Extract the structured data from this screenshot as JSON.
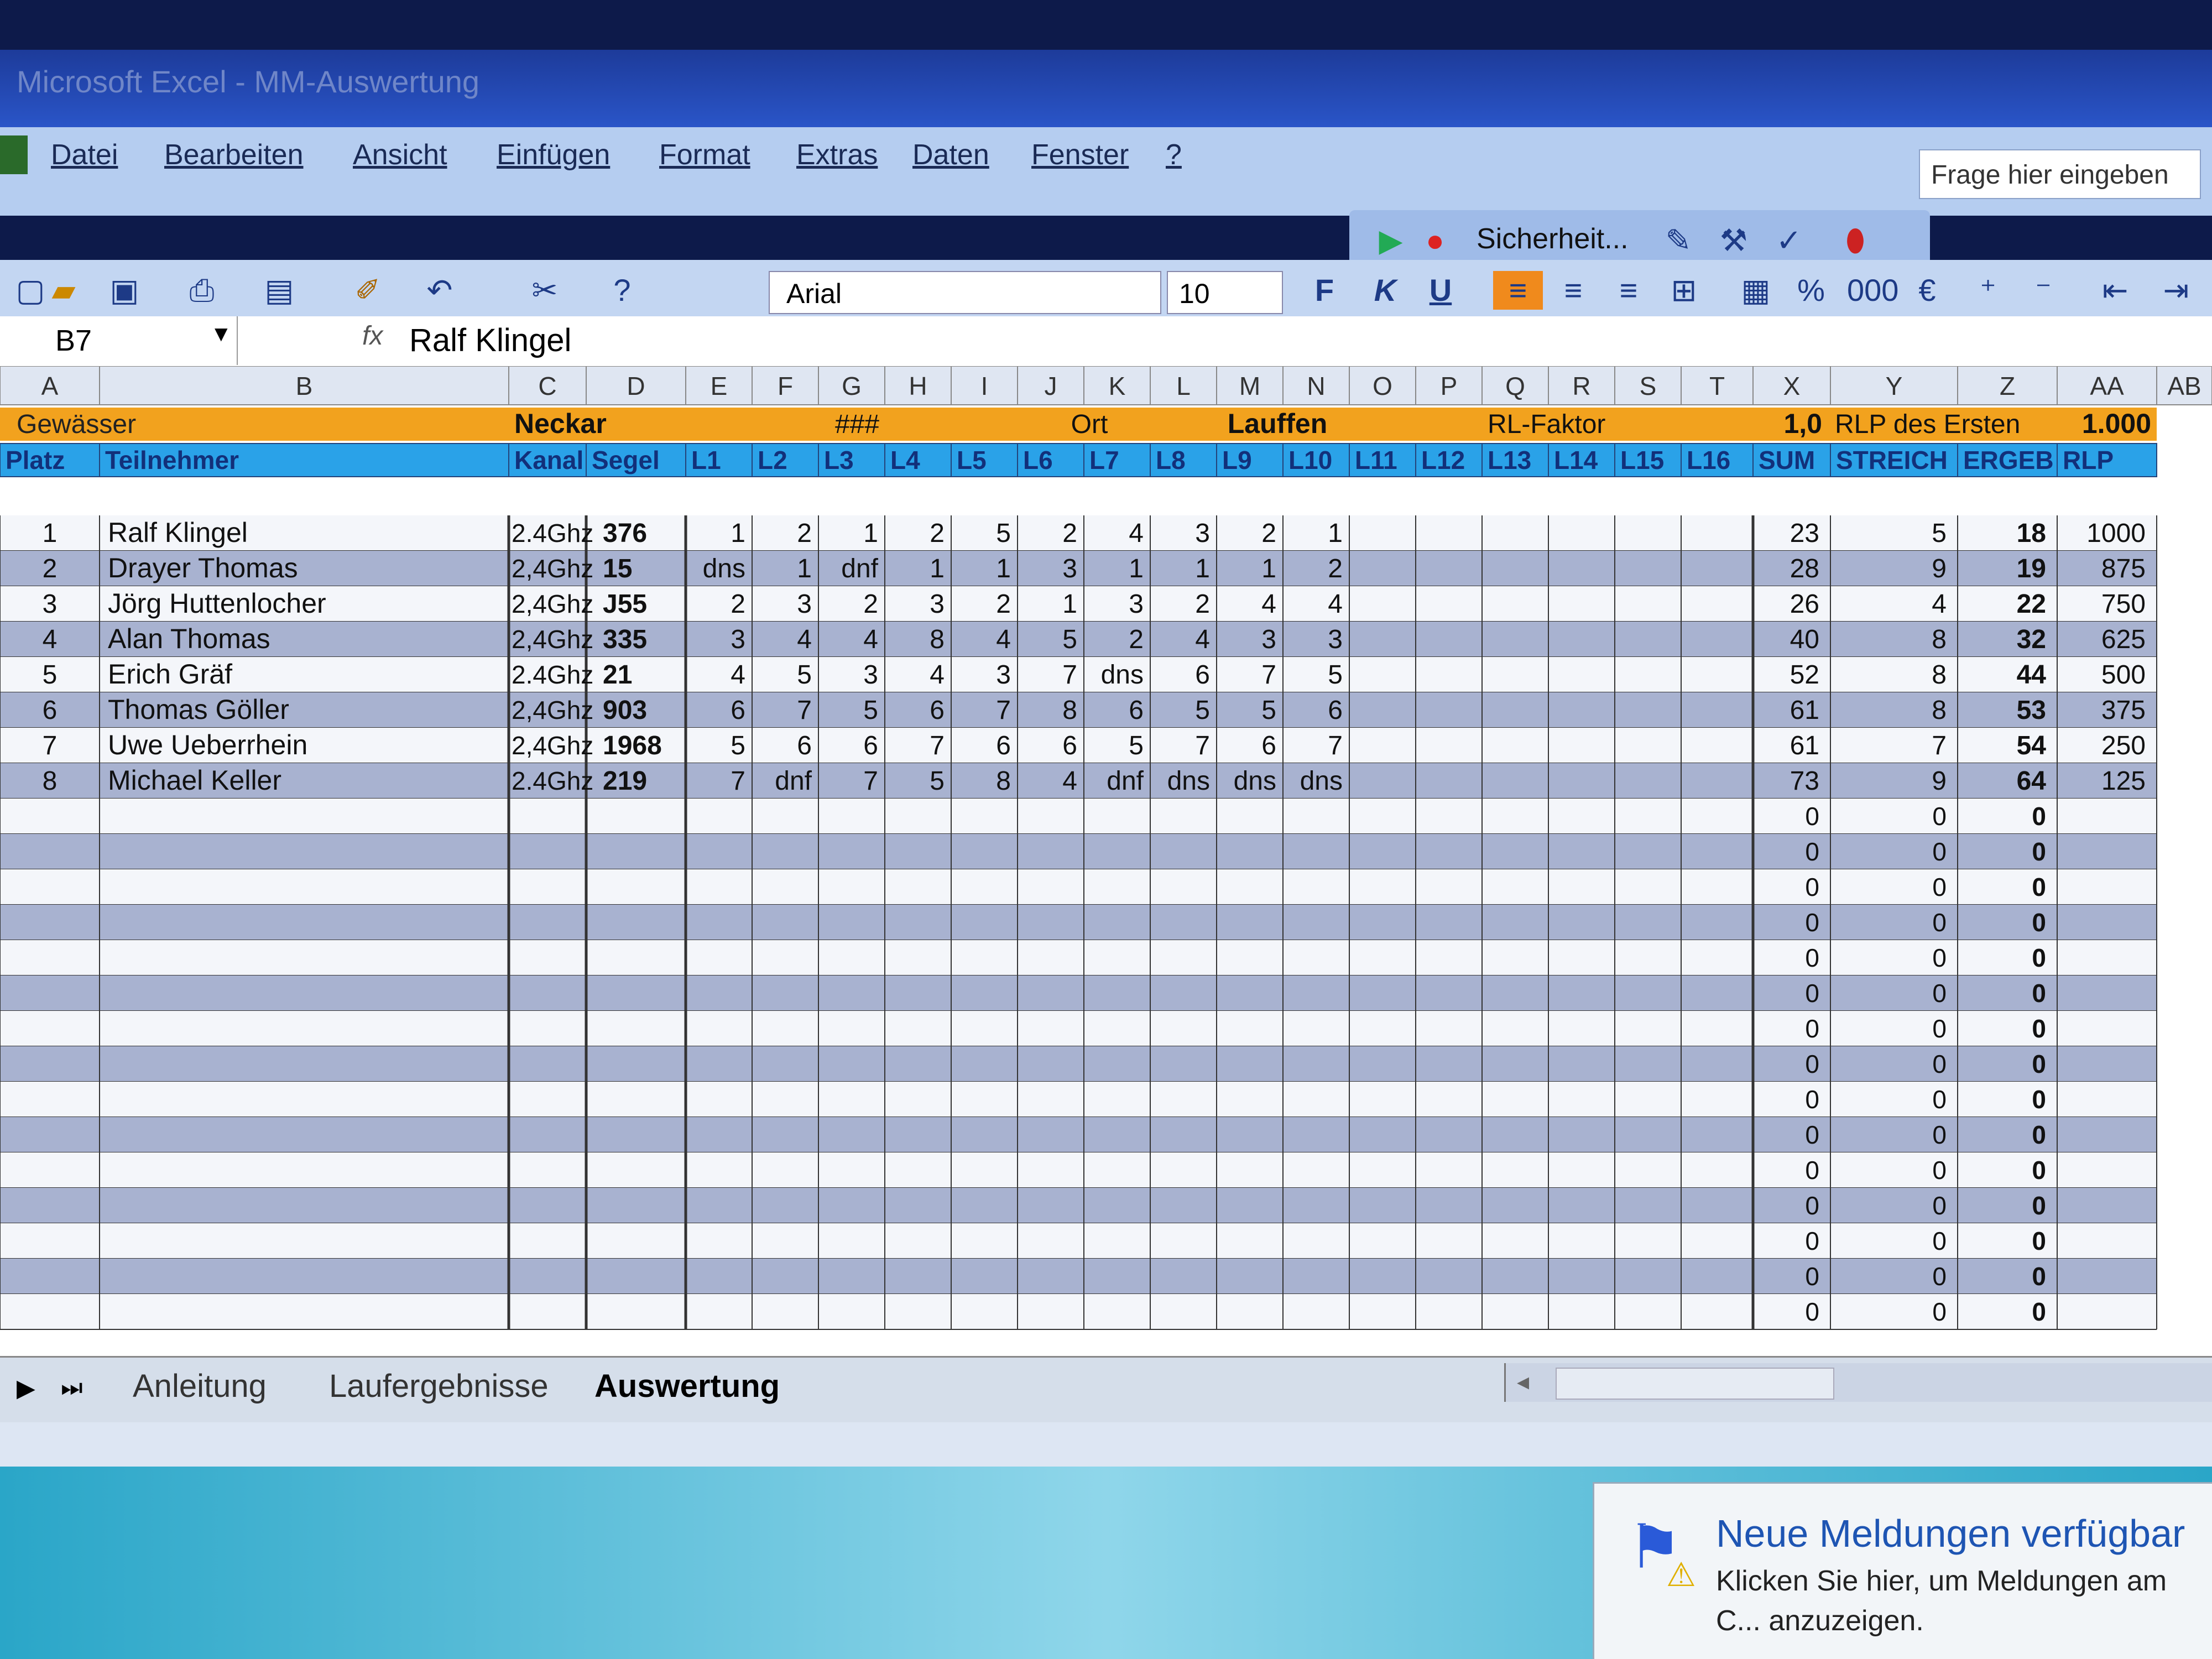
{
  "window": {
    "title": "Microsoft Excel - MM-Auswertung"
  },
  "menu": [
    "Datei",
    "Bearbeiten",
    "Ansicht",
    "Einfügen",
    "Format",
    "Extras",
    "Daten",
    "Fenster",
    "?"
  ],
  "ask_placeholder": "Frage hier eingeben",
  "security_label": "Sicherheit...",
  "font": "Arial",
  "font_size": "10",
  "format_buttons": [
    "F",
    "K",
    "U"
  ],
  "name_box": "B7",
  "formula_value": "Ralf Klingel",
  "columns": [
    "A",
    "B",
    "C",
    "D",
    "E",
    "F",
    "G",
    "H",
    "I",
    "J",
    "K",
    "L",
    "M",
    "N",
    "O",
    "P",
    "Q",
    "R",
    "S",
    "T",
    "X",
    "Y",
    "Z",
    "AA",
    "AB"
  ],
  "header_row1": {
    "gewaesser_label": "Gewässer",
    "gewaesser_value": "Neckar",
    "hash": "###",
    "ort_label": "Ort",
    "ort_value": "Lauffen",
    "rl_label": "RL-Faktor",
    "rl_value": "1,0",
    "rlp_label": "RLP des Ersten",
    "rlp_value": "1.000"
  },
  "header_row2": [
    "Platz",
    "Teilnehmer",
    "Kanal",
    "Segel",
    "L1",
    "L2",
    "L3",
    "L4",
    "L5",
    "L6",
    "L7",
    "L8",
    "L9",
    "L10",
    "L11",
    "L12",
    "L13",
    "L14",
    "L15",
    "L16",
    "SUM",
    "STREICH",
    "ERGEB",
    "RLP"
  ],
  "rows": [
    {
      "platz": "1",
      "name": "Ralf Klingel",
      "kanal": "2.4Ghz",
      "segel": "376",
      "laeufe": [
        "1",
        "2",
        "1",
        "2",
        "5",
        "2",
        "4",
        "3",
        "2",
        "1"
      ],
      "sum": "23",
      "streich": "5",
      "ergeb": "18",
      "rlp": "1000"
    },
    {
      "platz": "2",
      "name": "Drayer Thomas",
      "kanal": "2,4Ghz",
      "segel": "15",
      "laeufe": [
        "dns",
        "1",
        "dnf",
        "1",
        "1",
        "3",
        "1",
        "1",
        "1",
        "2"
      ],
      "sum": "28",
      "streich": "9",
      "ergeb": "19",
      "rlp": "875"
    },
    {
      "platz": "3",
      "name": "Jörg Huttenlocher",
      "kanal": "2,4Ghz",
      "segel": "J55",
      "laeufe": [
        "2",
        "3",
        "2",
        "3",
        "2",
        "1",
        "3",
        "2",
        "4",
        "4"
      ],
      "sum": "26",
      "streich": "4",
      "ergeb": "22",
      "rlp": "750"
    },
    {
      "platz": "4",
      "name": "Alan Thomas",
      "kanal": "2,4Ghz",
      "segel": "335",
      "laeufe": [
        "3",
        "4",
        "4",
        "8",
        "4",
        "5",
        "2",
        "4",
        "3",
        "3"
      ],
      "sum": "40",
      "streich": "8",
      "ergeb": "32",
      "rlp": "625"
    },
    {
      "platz": "5",
      "name": "Erich Gräf",
      "kanal": "2.4Ghz",
      "segel": "21",
      "laeufe": [
        "4",
        "5",
        "3",
        "4",
        "3",
        "7",
        "dns",
        "6",
        "7",
        "5"
      ],
      "sum": "52",
      "streich": "8",
      "ergeb": "44",
      "rlp": "500"
    },
    {
      "platz": "6",
      "name": "Thomas Göller",
      "kanal": "2,4Ghz",
      "segel": "903",
      "laeufe": [
        "6",
        "7",
        "5",
        "6",
        "7",
        "8",
        "6",
        "5",
        "5",
        "6"
      ],
      "sum": "61",
      "streich": "8",
      "ergeb": "53",
      "rlp": "375"
    },
    {
      "platz": "7",
      "name": "Uwe Ueberrhein",
      "kanal": "2,4Ghz",
      "segel": "1968",
      "laeufe": [
        "5",
        "6",
        "6",
        "7",
        "6",
        "6",
        "5",
        "7",
        "6",
        "7"
      ],
      "sum": "61",
      "streich": "7",
      "ergeb": "54",
      "rlp": "250"
    },
    {
      "platz": "8",
      "name": "Michael Keller",
      "kanal": "2.4Ghz",
      "segel": "219",
      "laeufe": [
        "7",
        "dnf",
        "7",
        "5",
        "8",
        "4",
        "dnf",
        "dns",
        "dns",
        "dns"
      ],
      "sum": "73",
      "streich": "9",
      "ergeb": "64",
      "rlp": "125"
    }
  ],
  "empty_row_value": "0",
  "empty_row_count": 15,
  "sheet_tabs": [
    "Anleitung",
    "Laufergebnisse",
    "Auswertung"
  ],
  "active_tab": "Auswertung",
  "notification": {
    "title": "Neue Meldungen verfügbar",
    "text": "Klicken Sie hier, um Meldungen am C... anzuzeigen."
  },
  "colors": {
    "orange": "#f2a21e",
    "blue": "#2aa2e8",
    "stripe": "#a8b2d0",
    "title_bar": "#1d3b9a"
  }
}
